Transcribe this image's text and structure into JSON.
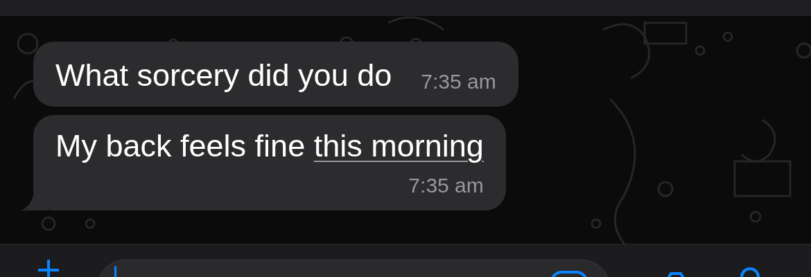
{
  "messages": [
    {
      "text": "What sorcery did you do",
      "time": "7:35 am",
      "tail": false
    },
    {
      "text": "My back feels fine ",
      "link": "this morning",
      "time": "7:35 am",
      "tail": true
    }
  ]
}
